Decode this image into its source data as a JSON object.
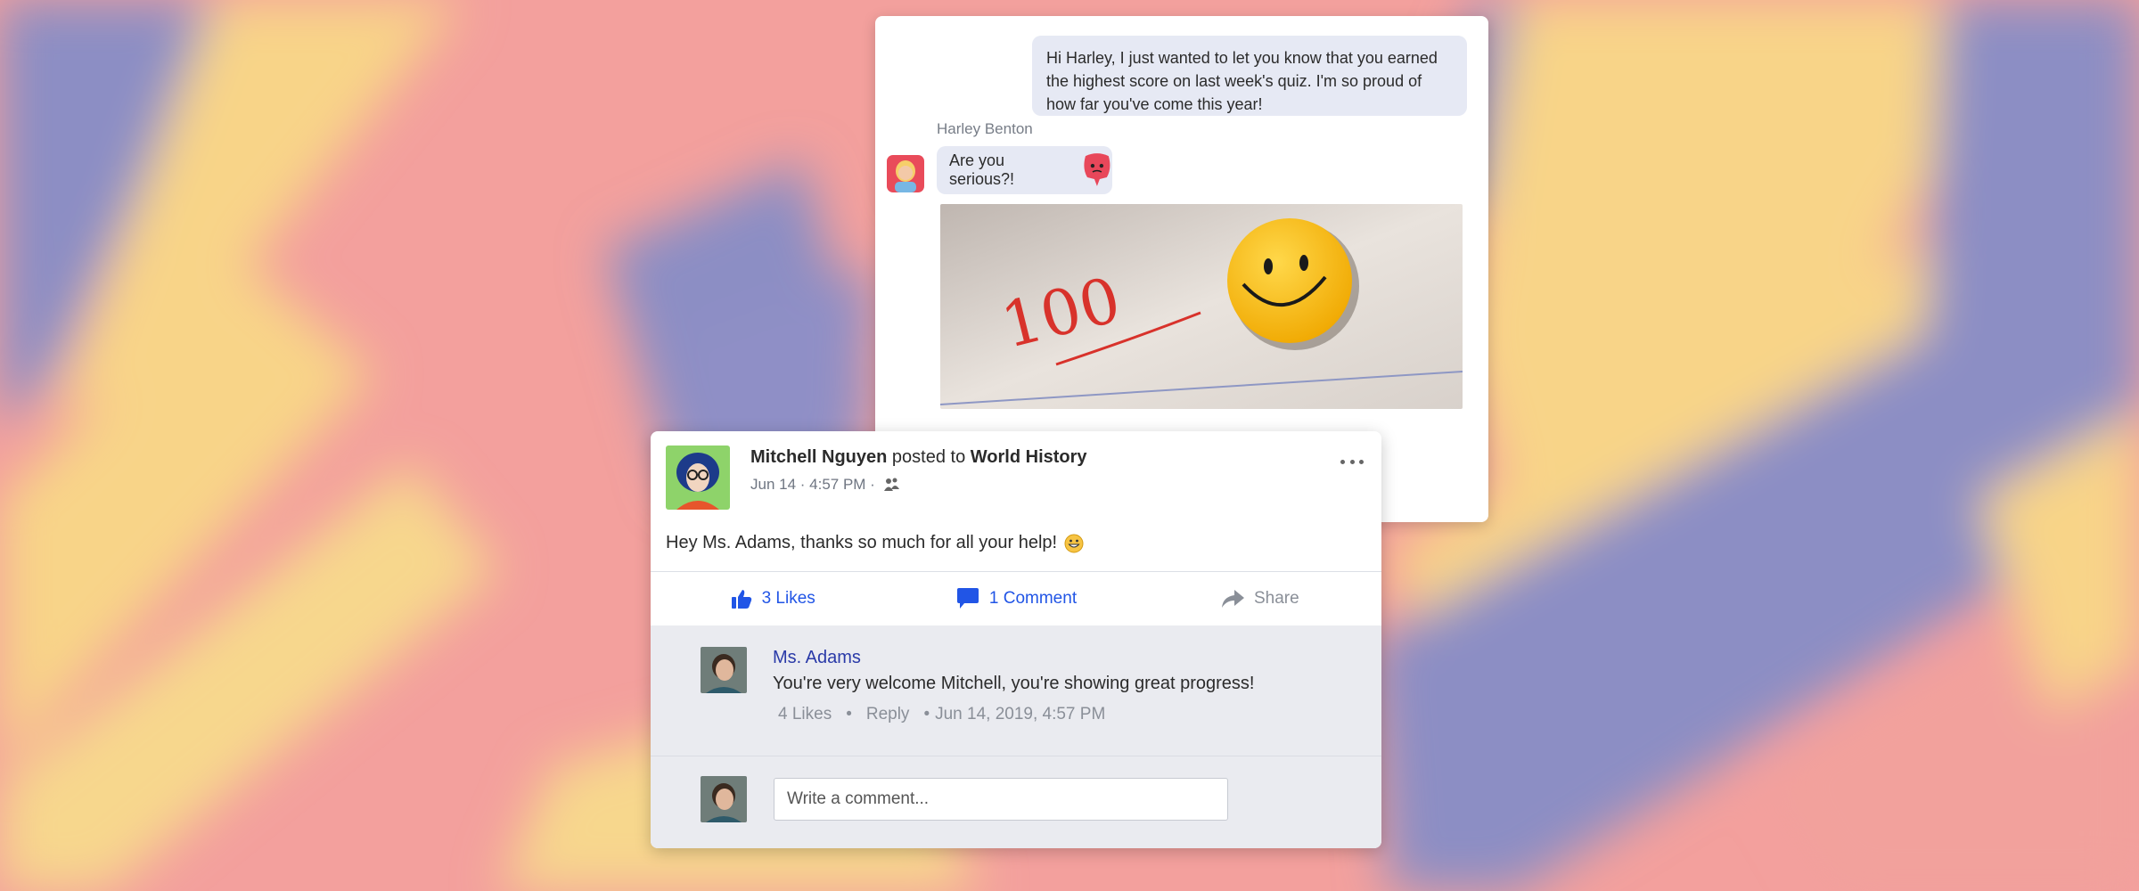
{
  "chat": {
    "outgoing_message": "Hi Harley, I just wanted to let you know that you earned the highest score on last week's quiz. I'm so proud of how far you've come this year!",
    "sender_name": "Harley Benton",
    "incoming_message": "Are you serious?!",
    "photo_text": "100"
  },
  "post": {
    "author": "Mitchell Nguyen",
    "posted_to_label": "posted to",
    "group": "World History",
    "timestamp": "Jun 14 · 4:57 PM ·",
    "body": "Hey Ms. Adams, thanks so much for all your help!",
    "likes_label": "3 Likes",
    "comments_label": "1 Comment",
    "share_label": "Share",
    "comment": {
      "author": "Ms. Adams",
      "text": "You're very welcome Mitchell, you're showing great progress!",
      "likes": "4 Likes",
      "reply": "Reply",
      "date": "Jun 14, 2019, 4:57 PM"
    },
    "comment_placeholder": "Write a comment..."
  },
  "colors": {
    "link_blue": "#2155e6",
    "author_blue": "#2a3aa8",
    "bubble": "#e6e9f4",
    "comment_bg": "#eaebf0"
  },
  "icons": [
    "thumbs-up-icon",
    "speech-bubble-icon",
    "share-arrow-icon",
    "more-options-icon",
    "audience-icon",
    "grinning-emoji-icon",
    "sticker-icon"
  ]
}
